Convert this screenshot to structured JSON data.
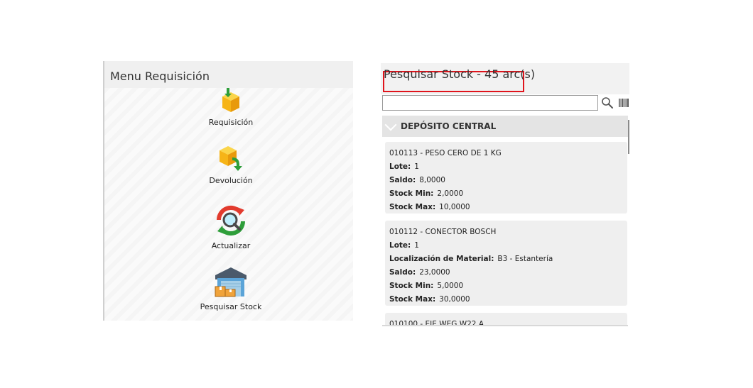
{
  "left": {
    "title": "Menu Requisición",
    "items": [
      {
        "label": "Requisición"
      },
      {
        "label": "Devolución"
      },
      {
        "label": "Actualizar"
      },
      {
        "label": "Pesquisar Stock"
      }
    ]
  },
  "right": {
    "title": "Pesquisar Stock - 45 arc(s)",
    "search": {
      "value": "",
      "placeholder": ""
    },
    "group": {
      "title": "DEPÓSITO CENTRAL"
    },
    "cards": [
      {
        "header": "010113 - PESO CERO DE 1 KG",
        "lote_label": "Lote:",
        "lote": "1",
        "saldo_label": "Saldo:",
        "saldo": "8,0000",
        "min_label": "Stock Min:",
        "min": "2,0000",
        "max_label": "Stock Max:",
        "max": "10,0000"
      },
      {
        "header": "010112 - CONECTOR BOSCH",
        "lote_label": "Lote:",
        "lote": "1",
        "loc_label": "Localización de Material:",
        "loc": "B3 - Estantería",
        "saldo_label": "Saldo:",
        "saldo": "23,0000",
        "min_label": "Stock Min:",
        "min": "5,0000",
        "max_label": "Stock Max:",
        "max": "30,0000"
      },
      {
        "header": "010100 - EJE WEG W22 A"
      }
    ]
  },
  "colors": {
    "highlight": "#e0141c",
    "box_yellow": "#f6b417",
    "arrow_green": "#2e9e3a",
    "refresh_red": "#e23b2e"
  },
  "icons": [
    "box-arrow-in-icon",
    "box-arrow-out-icon",
    "refresh-search-icon",
    "warehouse-icon",
    "search-icon",
    "barcode-icon",
    "chevron-down-icon"
  ]
}
